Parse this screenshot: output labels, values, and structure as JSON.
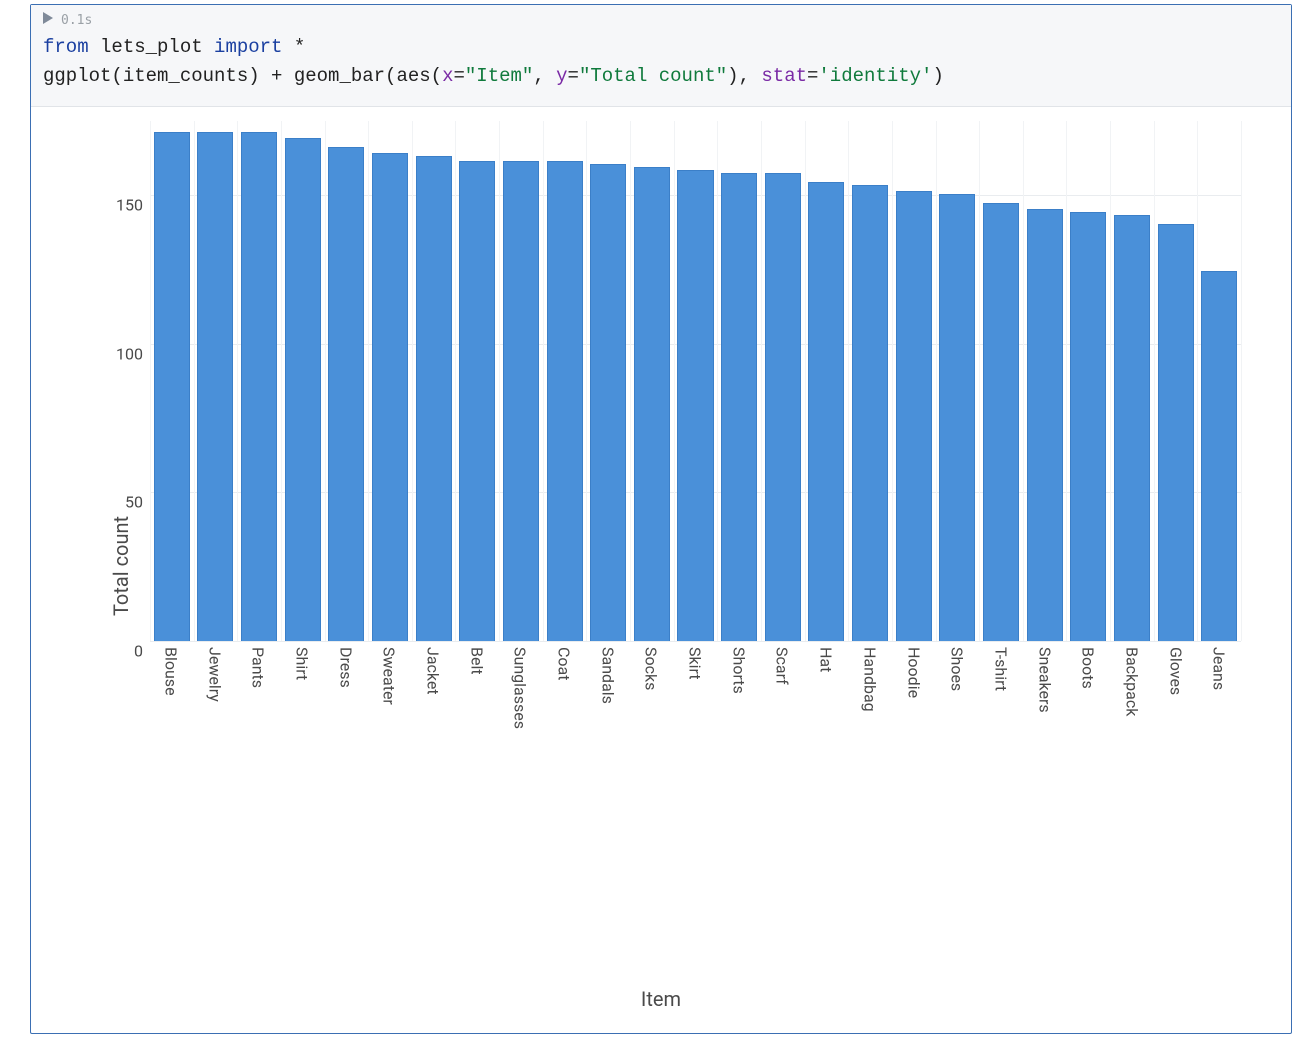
{
  "cell": {
    "exec_time": "0.1s",
    "code_tokens": [
      {
        "t": "from ",
        "c": "kw"
      },
      {
        "t": "lets_plot ",
        "c": "fn"
      },
      {
        "t": "import ",
        "c": "kw"
      },
      {
        "t": "*",
        "c": "op"
      },
      {
        "t": "\n",
        "c": ""
      },
      {
        "t": "ggplot(item_counts) + geom_bar(aes(",
        "c": "fn"
      },
      {
        "t": "x",
        "c": "arg"
      },
      {
        "t": "=",
        "c": "op"
      },
      {
        "t": "\"Item\"",
        "c": "str"
      },
      {
        "t": ", ",
        "c": "fn"
      },
      {
        "t": "y",
        "c": "arg"
      },
      {
        "t": "=",
        "c": "op"
      },
      {
        "t": "\"Total count\"",
        "c": "str"
      },
      {
        "t": "), ",
        "c": "fn"
      },
      {
        "t": "stat",
        "c": "arg"
      },
      {
        "t": "=",
        "c": "op"
      },
      {
        "t": "'identity'",
        "c": "str"
      },
      {
        "t": ")",
        "c": "fn"
      }
    ]
  },
  "chart_data": {
    "type": "bar",
    "title": "",
    "xlabel": "Item",
    "ylabel": "Total count",
    "ylim": [
      0,
      175
    ],
    "y_ticks": [
      0,
      50,
      100,
      150
    ],
    "categories": [
      "Blouse",
      "Jewelry",
      "Pants",
      "Shirt",
      "Dress",
      "Sweater",
      "Jacket",
      "Belt",
      "Sunglasses",
      "Coat",
      "Sandals",
      "Socks",
      "Skirt",
      "Shorts",
      "Scarf",
      "Hat",
      "Handbag",
      "Hoodie",
      "Shoes",
      "T-shirt",
      "Sneakers",
      "Boots",
      "Backpack",
      "Gloves",
      "Jeans"
    ],
    "values": [
      171,
      171,
      171,
      169,
      166,
      164,
      163,
      161,
      161,
      161,
      160,
      159,
      158,
      157,
      157,
      154,
      153,
      151,
      150,
      147,
      145,
      144,
      143,
      140,
      124
    ]
  }
}
